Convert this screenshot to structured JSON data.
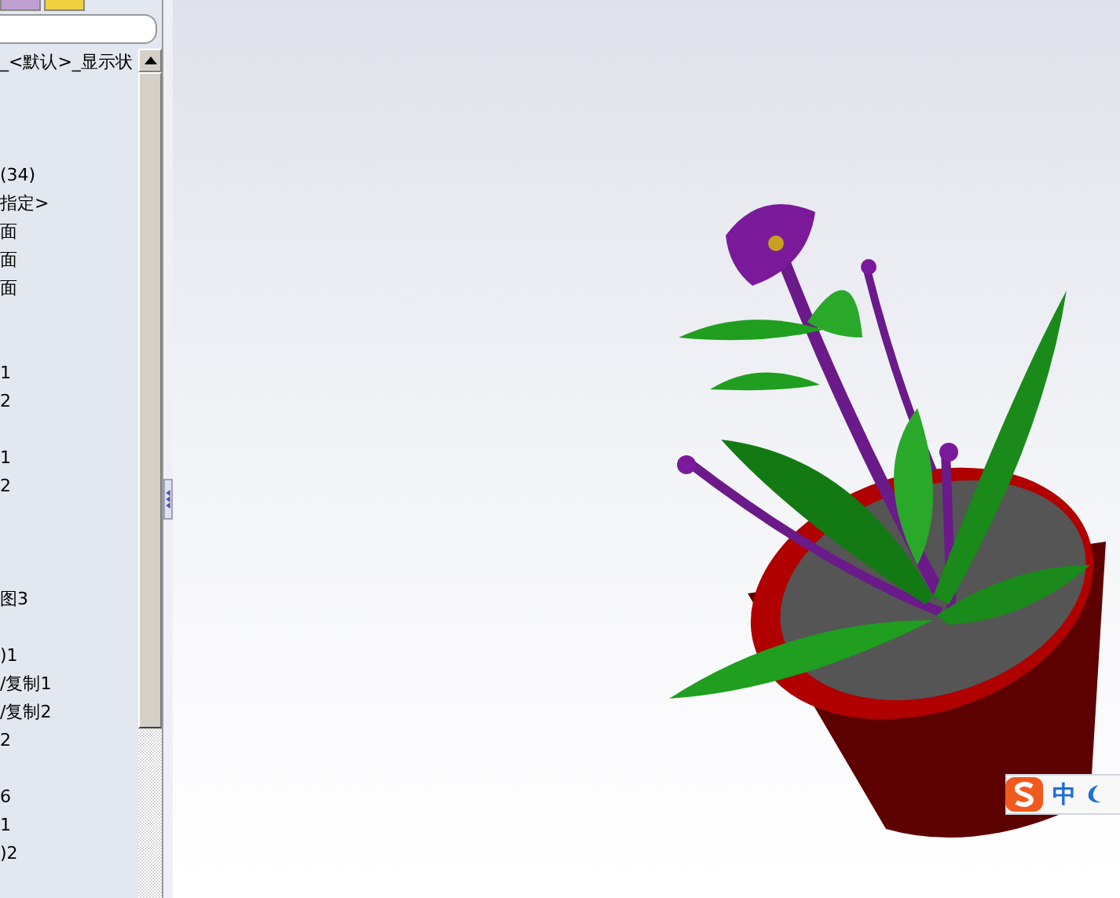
{
  "feature_tree": {
    "items": [
      {
        "label": "_<默认>_显示状"
      },
      {
        "label": "(34)"
      },
      {
        "label": "指定>"
      },
      {
        "label": "面"
      },
      {
        "label": "面"
      },
      {
        "label": "面"
      },
      {
        "label": "1"
      },
      {
        "label": "2"
      },
      {
        "label": "1"
      },
      {
        "label": "2"
      },
      {
        "label": "图3"
      },
      {
        "label": ")1"
      },
      {
        "label": "/复制1"
      },
      {
        "label": "/复制2"
      },
      {
        "label": "2"
      },
      {
        "label": "6"
      },
      {
        "label": "1"
      },
      {
        "label": ")2"
      }
    ]
  },
  "ime_bar": {
    "mode": "中"
  }
}
